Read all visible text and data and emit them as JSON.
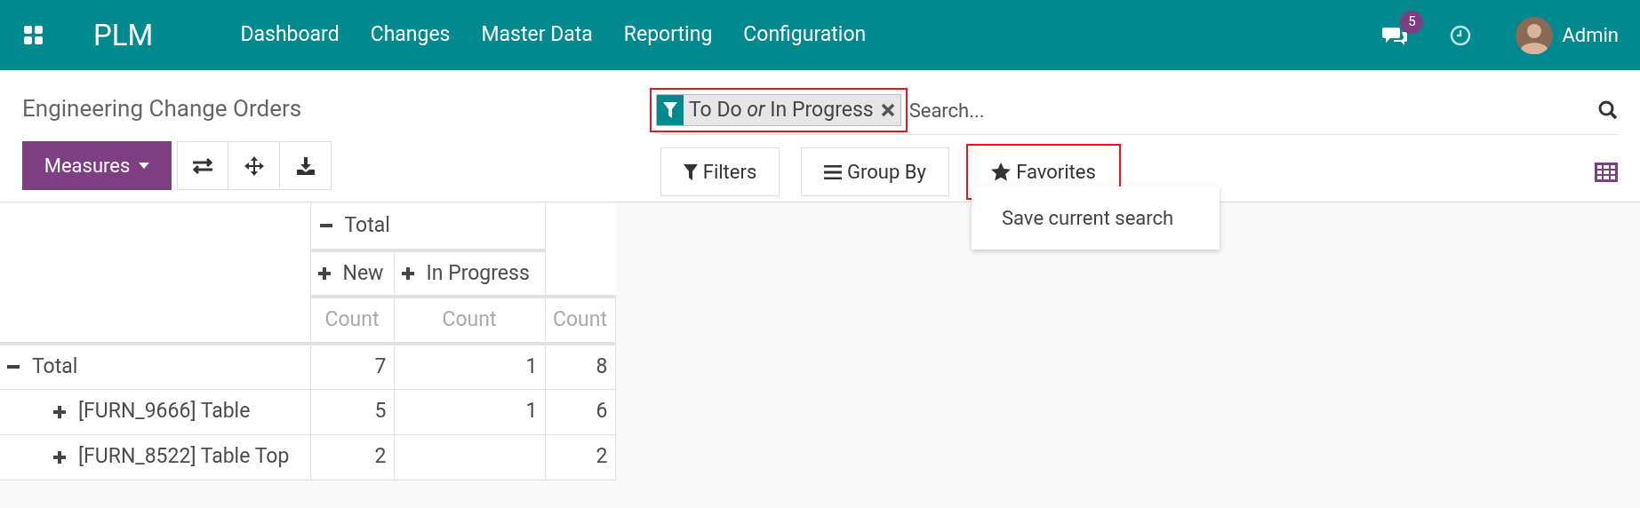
{
  "navbar": {
    "app_name": "PLM",
    "menu": [
      "Dashboard",
      "Changes",
      "Master Data",
      "Reporting",
      "Configuration"
    ],
    "messages_count": "5",
    "user": "Admin"
  },
  "title": "Engineering Change Orders",
  "search": {
    "facet": "To Do *or* In Progress",
    "placeholder": "Search..."
  },
  "toolbar": {
    "measures": "Measures",
    "filters": "Filters",
    "group_by": "Group By",
    "favorites": "Favorites"
  },
  "favorites_menu": [
    "Save current search"
  ],
  "pivot": {
    "column_header": {
      "label": "Total",
      "expanded": true
    },
    "sub_columns": [
      {
        "label": "New",
        "expanded": false
      },
      {
        "label": "In Progress",
        "expanded": false
      }
    ],
    "measures": [
      "Count",
      "Count",
      "Count"
    ],
    "rows": [
      {
        "label": "Total",
        "expanded": true,
        "cells": [
          "7",
          "1",
          "8"
        ],
        "children": [
          {
            "label": "[FURN_9666] Table",
            "expanded": false,
            "cells": [
              "5",
              "1",
              "6"
            ]
          },
          {
            "label": "[FURN_8522] Table Top",
            "expanded": false,
            "cells": [
              "2",
              "",
              "2"
            ]
          }
        ]
      }
    ]
  }
}
